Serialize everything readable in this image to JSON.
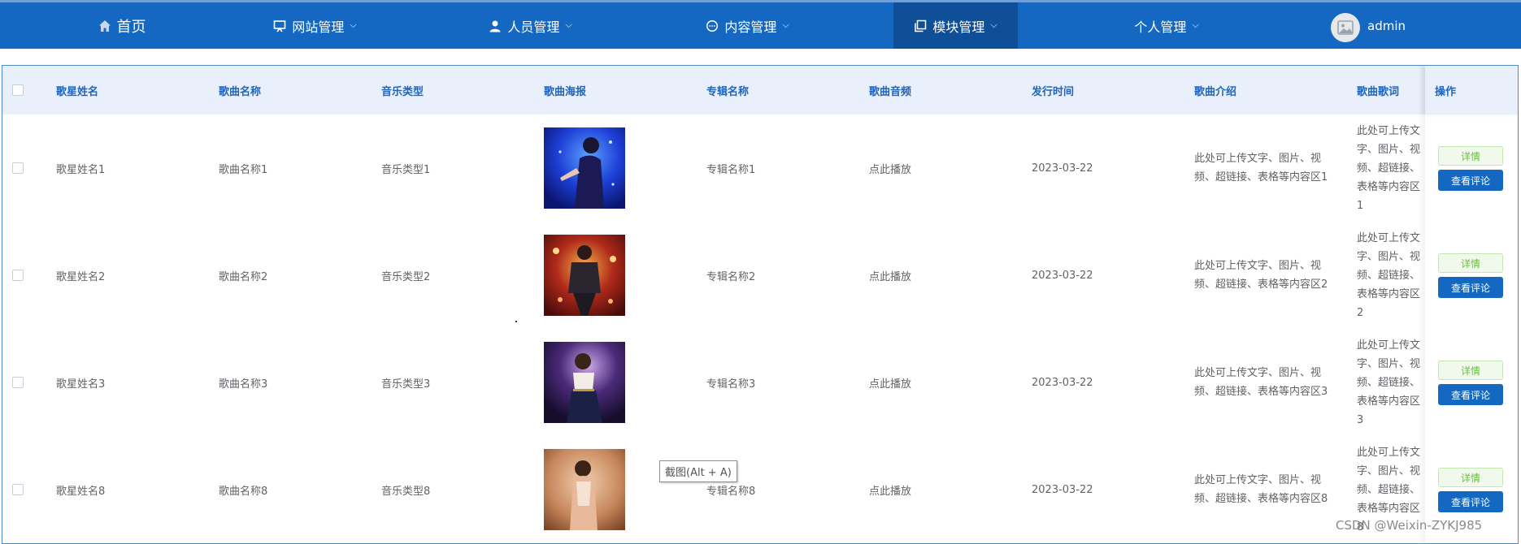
{
  "nav": {
    "home": "首页",
    "site_mgmt": "网站管理",
    "user_mgmt": "人员管理",
    "content_mgmt": "内容管理",
    "module_mgmt": "模块管理",
    "personal_mgmt": "个人管理",
    "username": "admin"
  },
  "table": {
    "columns": [
      "歌星姓名",
      "歌曲名称",
      "音乐类型",
      "歌曲海报",
      "专辑名称",
      "歌曲音频",
      "发行时间",
      "歌曲介绍",
      "歌曲歌词",
      "操作"
    ],
    "rows": [
      {
        "singer": "歌星姓名1",
        "song": "歌曲名称1",
        "type": "音乐类型1",
        "album": "专辑名称1",
        "audio": "点此播放",
        "date": "2023-03-22",
        "intro": "此处可上传文字、图片、视频、超链接、表格等内容区1",
        "lyrics": "此处可上传文字、图片、视频、超链接、表格等内容区1"
      },
      {
        "singer": "歌星姓名2",
        "song": "歌曲名称2",
        "type": "音乐类型2",
        "album": "专辑名称2",
        "audio": "点此播放",
        "date": "2023-03-22",
        "intro": "此处可上传文字、图片、视频、超链接、表格等内容区2",
        "lyrics": "此处可上传文字、图片、视频、超链接、表格等内容区2"
      },
      {
        "singer": "歌星姓名3",
        "song": "歌曲名称3",
        "type": "音乐类型3",
        "album": "专辑名称3",
        "audio": "点此播放",
        "date": "2023-03-22",
        "intro": "此处可上传文字、图片、视频、超链接、表格等内容区3",
        "lyrics": "此处可上传文字、图片、视频、超链接、表格等内容区3"
      },
      {
        "singer": "歌星姓名8",
        "song": "歌曲名称8",
        "type": "音乐类型8",
        "album": "专辑名称8",
        "audio": "点此播放",
        "date": "2023-03-22",
        "intro": "此处可上传文字、图片、视频、超链接、表格等内容区8",
        "lyrics": "此处可上传文字、图片、视频、超链接、表格等内容区8"
      }
    ],
    "actions": {
      "detail": "详情",
      "comment": "查看评论"
    }
  },
  "tooltip": "截图(Alt + A)",
  "watermark": "CSDN @Weixin-ZYKJ985",
  "colors": {
    "nav_bg": "#1568c2",
    "nav_active": "#0e4f98",
    "header_text": "#1f66bb",
    "detail_green": "#67c23a"
  }
}
